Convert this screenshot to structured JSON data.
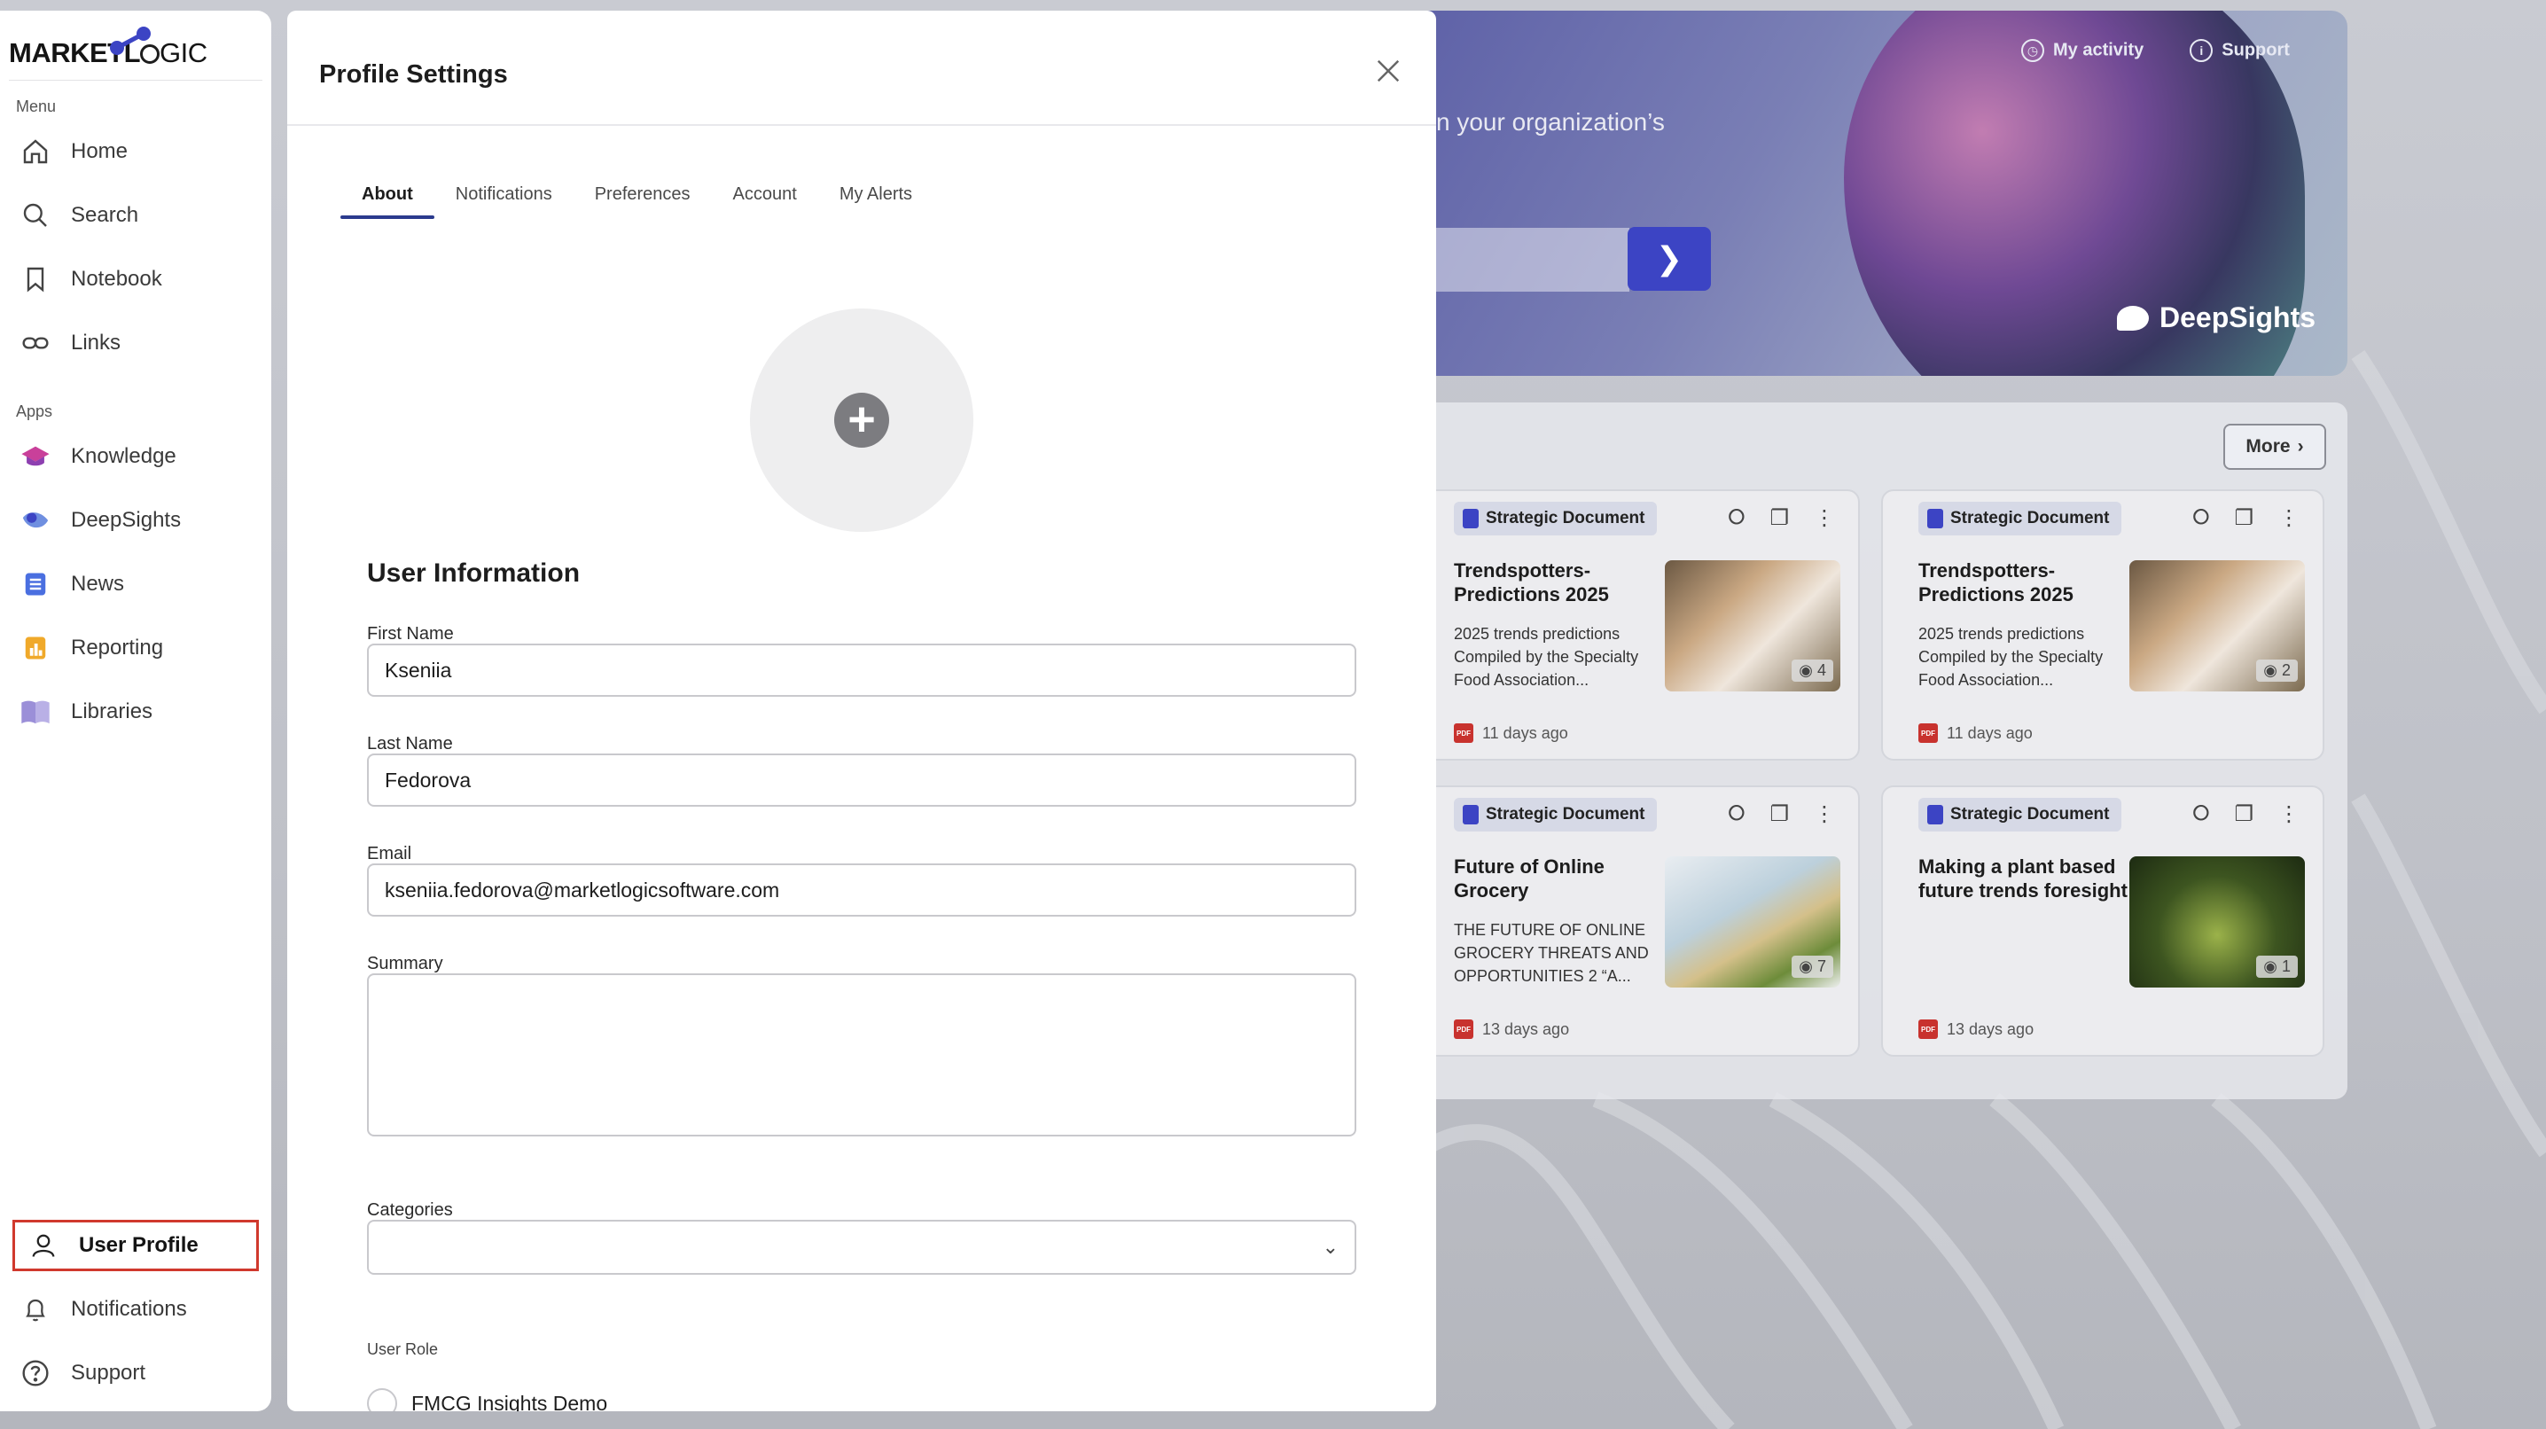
{
  "sidebar": {
    "brand_bold": "MARKETL",
    "brand_light": "GIC",
    "menu_label": "Menu",
    "apps_label": "Apps",
    "menu_items": [
      {
        "label": "Home",
        "icon": "home-icon"
      },
      {
        "label": "Search",
        "icon": "search-icon"
      },
      {
        "label": "Notebook",
        "icon": "bookmark-icon"
      },
      {
        "label": "Links",
        "icon": "link-icon"
      }
    ],
    "app_items": [
      {
        "label": "Knowledge",
        "icon": "graduation-cap-icon"
      },
      {
        "label": "DeepSights",
        "icon": "deepsights-icon"
      },
      {
        "label": "News",
        "icon": "news-icon"
      },
      {
        "label": "Reporting",
        "icon": "bar-chart-icon"
      },
      {
        "label": "Libraries",
        "icon": "book-icon"
      }
    ],
    "bottom_items": [
      {
        "label": "User Profile",
        "icon": "user-icon"
      },
      {
        "label": "Notifications",
        "icon": "bell-icon"
      },
      {
        "label": "Support",
        "icon": "help-icon"
      }
    ]
  },
  "background": {
    "hero_text": "n your organization’s",
    "links": {
      "activity": "My activity",
      "support": "Support"
    },
    "brand": "DeepSights",
    "more_label": "More",
    "cards": [
      {
        "tag": "Strategic Document",
        "title": "Trendspotters-Predictions 2025",
        "desc": "2025 trends predictions Compiled by the Specialty Food Association...",
        "views": "4",
        "age": "11 days ago"
      },
      {
        "tag": "Strategic Document",
        "title": "Trendspotters-Predictions 2025",
        "desc": "2025 trends predictions Compiled by the Specialty Food Association...",
        "views": "2",
        "age": "11 days ago"
      },
      {
        "tag": "Strategic Document",
        "title": "Future of Online Grocery",
        "desc": "THE FUTURE OF ONLINE GROCERY THREATS AND OPPORTUNITIES 2 “A...",
        "views": "7",
        "age": "13 days ago"
      },
      {
        "tag": "Strategic Document",
        "title": "Making a plant based future trends foresight",
        "desc": "",
        "views": "1",
        "age": "13 days ago"
      }
    ],
    "colors": {
      "accent": "#3c44c4",
      "pdf": "#c8322e"
    }
  },
  "modal": {
    "title": "Profile Settings",
    "tabs": [
      "About",
      "Notifications",
      "Preferences",
      "Account",
      "My Alerts"
    ],
    "active_tab": "About",
    "section_heading": "User Information",
    "first_name": {
      "label": "First Name",
      "value": "Kseniia"
    },
    "last_name": {
      "label": "Last Name",
      "value": "Fedorova"
    },
    "email": {
      "label": "Email",
      "value": "kseniia.fedorova@marketlogicsoftware.com"
    },
    "summary": {
      "label": "Summary",
      "value": ""
    },
    "categories": {
      "label": "Categories",
      "value": ""
    },
    "user_role": {
      "label": "User Role",
      "option": "FMCG Insights Demo"
    }
  }
}
